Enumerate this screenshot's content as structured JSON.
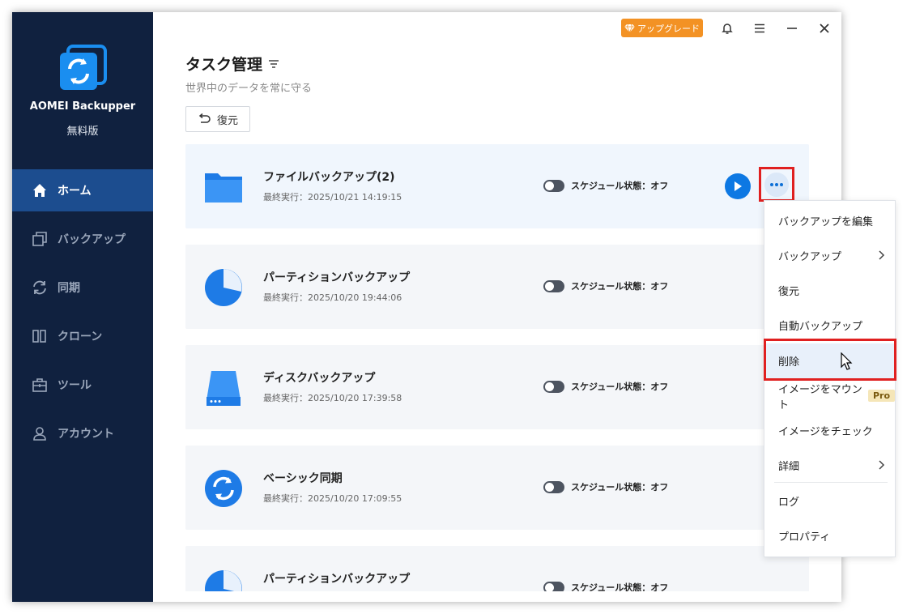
{
  "app": {
    "name": "AOMEI Backupper",
    "edition": "無料版"
  },
  "sidebar": {
    "items": [
      {
        "label": "ホーム",
        "icon": "home-icon"
      },
      {
        "label": "バックアップ",
        "icon": "backup-icon"
      },
      {
        "label": "同期",
        "icon": "sync-icon"
      },
      {
        "label": "クローン",
        "icon": "clone-icon"
      },
      {
        "label": "ツール",
        "icon": "tools-icon"
      },
      {
        "label": "アカウント",
        "icon": "account-icon"
      }
    ]
  },
  "header": {
    "upgrade_label": "アップグレード"
  },
  "page": {
    "title": "タスク管理",
    "subtitle": "世界中のデータを常に守る",
    "restore_label": "復元"
  },
  "tasks": [
    {
      "name": "ファイルバックアップ(2)",
      "last_run": "最終実行：2025/10/21 14:19:15",
      "schedule": "スケジュール状態：オフ",
      "icon": "folder-icon"
    },
    {
      "name": "パーティションバックアップ",
      "last_run": "最終実行：2025/10/20 19:44:06",
      "schedule": "スケジュール状態：オフ",
      "icon": "partition-icon"
    },
    {
      "name": "ディスクバックアップ",
      "last_run": "最終実行：2025/10/20 17:39:58",
      "schedule": "スケジュール状態：オフ",
      "icon": "disk-icon"
    },
    {
      "name": "ベーシック同期",
      "last_run": "最終実行：2025/10/20 17:09:55",
      "schedule": "スケジュール状態：オフ",
      "icon": "sync-icon"
    },
    {
      "name": "パーティションバックアップ",
      "last_run": "",
      "schedule": "スケジュール状態：オフ",
      "icon": "partition-icon"
    }
  ],
  "context_menu": {
    "items": [
      {
        "label": "バックアップを編集"
      },
      {
        "label": "バックアップ",
        "submenu": true
      },
      {
        "label": "復元"
      },
      {
        "label": "自動バックアップ"
      },
      {
        "label": "削除",
        "highlighted": true
      },
      {
        "label": "イメージをマウント",
        "badge": "Pro"
      },
      {
        "label": "イメージをチェック"
      },
      {
        "label": "詳細",
        "submenu": true
      },
      {
        "label": "ログ"
      },
      {
        "label": "プロパティ"
      }
    ]
  },
  "colors": {
    "sidebar_bg": "#10213f",
    "sidebar_active": "#1c4d8f",
    "accent": "#0d78e3",
    "upgrade": "#f39224",
    "highlight_red": "#e02020"
  }
}
